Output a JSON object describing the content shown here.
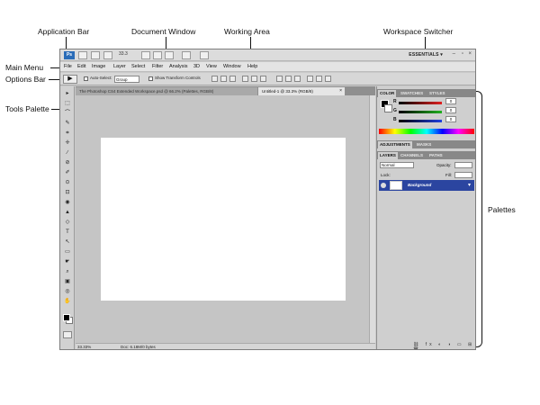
{
  "callouts": {
    "application_bar": "Application Bar",
    "document_window": "Document Window",
    "working_area": "Working Area",
    "workspace_switcher": "Workspace Switcher",
    "main_menu": "Main Menu",
    "options_bar": "Options Bar",
    "tools_palette": "Tools Palette",
    "palettes": "Palettes"
  },
  "app_bar": {
    "logo": "Ps",
    "zoom": "33.3",
    "workspace": "ESSENTIALS ▾",
    "window_controls": [
      "–",
      "▫",
      "×"
    ]
  },
  "menu": [
    "File",
    "Edit",
    "Image",
    "Layer",
    "Select",
    "Filter",
    "Analysis",
    "3D",
    "View",
    "Window",
    "Help"
  ],
  "options_bar": {
    "tool_glyph": "▶",
    "auto_select_label": "Auto-Select:",
    "auto_select_value": "Group",
    "transform_label": "Show Transform Controls"
  },
  "tools": [
    "▸",
    "⬚",
    "⌒",
    "✎",
    "⌗",
    "✛",
    "∕",
    "⊘",
    "✐",
    "⊙",
    "⊡",
    "◉",
    "▲",
    "◇",
    "T",
    "↖",
    "▭",
    "☛",
    "⌕",
    "▣",
    "◎",
    "✋"
  ],
  "document": {
    "tab_inactive": "The Photoshop CS4 Extended Workspace.psd @ 66.2% (Palettes, RGB/8)",
    "tab_active": "Untitled-1 @ 33.3% (RGB/8)",
    "tab_close": "×",
    "status_zoom": "33.33%",
    "status_doc": "Doc: 6.18M/0 bytes"
  },
  "palettes": {
    "color_tabs": [
      "COLOR",
      "SWATCHES",
      "STYLES"
    ],
    "sliders": [
      {
        "label": "R",
        "value": "0",
        "color": "#e02020"
      },
      {
        "label": "G",
        "value": "0",
        "color": "#20b020"
      },
      {
        "label": "B",
        "value": "0",
        "color": "#2040e0"
      }
    ],
    "adjust_tabs": [
      "ADJUSTMENTS",
      "MASKS"
    ],
    "layer_tabs": [
      "LAYERS",
      "CHANNELS",
      "PATHS"
    ],
    "blend_mode": "Normal",
    "opacity_label": "Opacity:",
    "fill_label": "Fill:",
    "lock_label": "Lock:",
    "layer_name": "Background",
    "bottom_icons": "⛓ fx ◐ ◑ ▭ ⊞ 🗑"
  },
  "colors": {
    "accent": "#2a6cb8",
    "selected_layer": "#2b45a0",
    "canvas": "#ffffff",
    "workspace_gray": "#c5c5c5"
  }
}
